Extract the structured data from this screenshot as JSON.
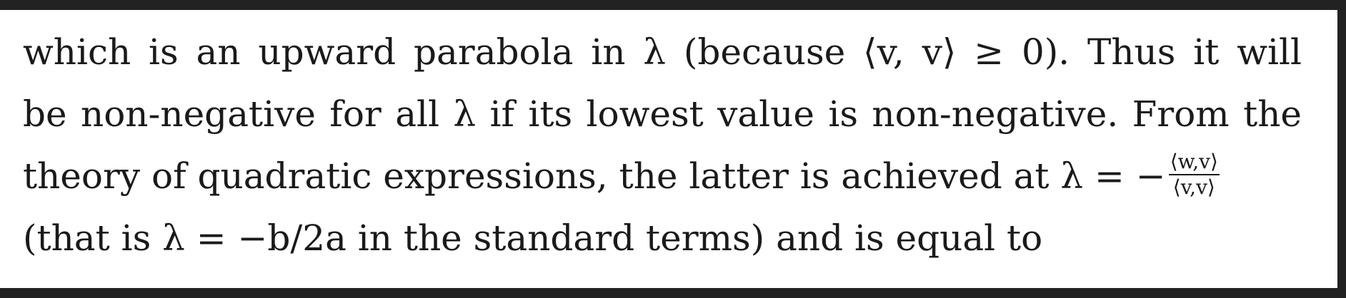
{
  "paragraph": {
    "line1": "which is an upward parabola in λ (because ⟨v, v⟩ ≥ 0). Thus it will",
    "line2": "be non-negative for all λ if its lowest value is non-negative. From the",
    "line3_text": "theory of quadratic expressions, the latter is achieved at λ = −",
    "line3_frac_num": "⟨w,v⟩",
    "line3_frac_den": "⟨v,v⟩",
    "line4": "(that is λ = −b/2a in the standard terms) and is equal to"
  }
}
